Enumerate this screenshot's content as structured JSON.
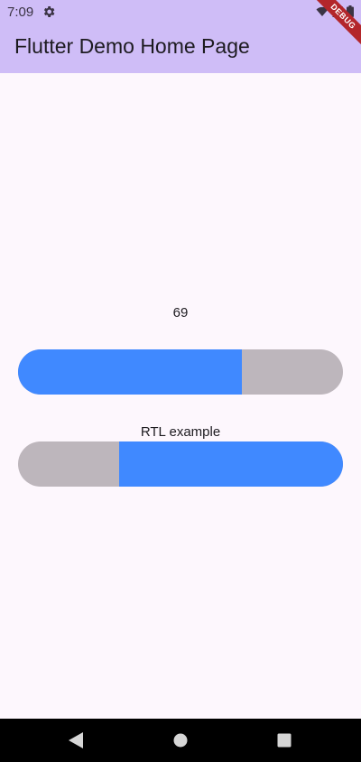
{
  "status_bar": {
    "time": "7:09",
    "settings_icon": "gear-icon",
    "right_icons": [
      "wifi-icon",
      "signal-icon",
      "battery-icon"
    ]
  },
  "app_bar": {
    "title": "Flutter Demo Home Page"
  },
  "debug_banner": {
    "label": "DEBUG",
    "color": "#b3262b"
  },
  "main": {
    "value_label": "69",
    "ltr_slider": {
      "value_fraction": 0.69,
      "fill_color": "#4089ff",
      "track_color": "#bdb6bc"
    },
    "rtl_label": "RTL example",
    "rtl_slider": {
      "value_fraction": 0.69,
      "fill_color": "#4089ff",
      "track_color": "#bdb6bc"
    }
  },
  "nav_bar": {
    "buttons": [
      "back-icon",
      "home-icon",
      "recents-icon"
    ]
  },
  "colors": {
    "app_bar": "#cfbdf7",
    "background": "#fdf7fd",
    "accent": "#4089ff"
  }
}
